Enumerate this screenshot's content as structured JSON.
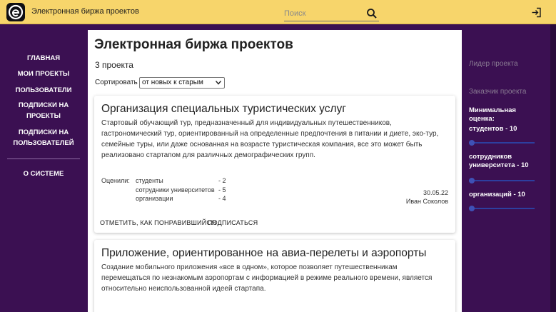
{
  "header": {
    "app_title": "Электронная биржа проектов",
    "search_placeholder": "Поиск",
    "colors": {
      "bar": "#f7d56b",
      "background": "#3b1052"
    }
  },
  "sidebar": {
    "items": [
      {
        "label": "ГЛАВНАЯ"
      },
      {
        "label": "МОИ ПРОЕКТЫ"
      },
      {
        "label": "ПОЛЬЗОВАТЕЛИ"
      },
      {
        "label": "ПОДПИСКИ НА ПРОЕКТЫ"
      },
      {
        "label": "ПОДПИСКИ НА ПОЛЬЗОВАТЕЛЕЙ"
      },
      {
        "label": "О СИСТЕМЕ"
      }
    ]
  },
  "main": {
    "title": "Электронная биржа проектов",
    "count": "3 проекта",
    "sort_label": "Сортировать",
    "sort_value": "от новых к старым",
    "projects": [
      {
        "title": "Организация специальных туристических услуг",
        "description": "Стартовый обучающий тур, предназначенный для индивидуальных путешественников, гастрономический тур, ориентированный на определенные предпочтения в питании и диете, эко-тур, семейные туры, или даже основанная на возрасте туристическая компания, все это может быть реализовано стартапом для различных демографических групп.",
        "ratings_label": "Оценили:",
        "ratings": [
          {
            "label": "студенты",
            "value": "- 2"
          },
          {
            "label": "сотрудники университетов",
            "value": "- 5"
          },
          {
            "label": "организации",
            "value": "- 4"
          }
        ],
        "date": "30.05.22",
        "author": "Иван Соколов",
        "like_label": "ОТМЕТИТЬ, КАК ПОНРАВИВШИЙСЯ",
        "subscribe_label": "ПОДПИСАТЬСЯ"
      },
      {
        "title": "Приложение, ориентированное на авиа-перелеты и аэропорты",
        "description": "Создание мобильного приложения «все в одном», которое позволяет путешественникам перемещаться по незнакомым аэропортам с информацией в режиме реального времени, является относительно неиспользованной идеей стартапа."
      }
    ]
  },
  "filters": {
    "leader_heading": "Лидер проекта",
    "customer_heading": "Заказчик проекта",
    "min_rating_title": "Минимальная оценка:",
    "sliders": [
      {
        "label": "студентов - 10",
        "value": 0
      },
      {
        "label": "сотрудников университета - 10",
        "value": 0
      },
      {
        "label": "организаций - 10",
        "value": 0
      }
    ],
    "accent_color": "#3f51b5"
  }
}
